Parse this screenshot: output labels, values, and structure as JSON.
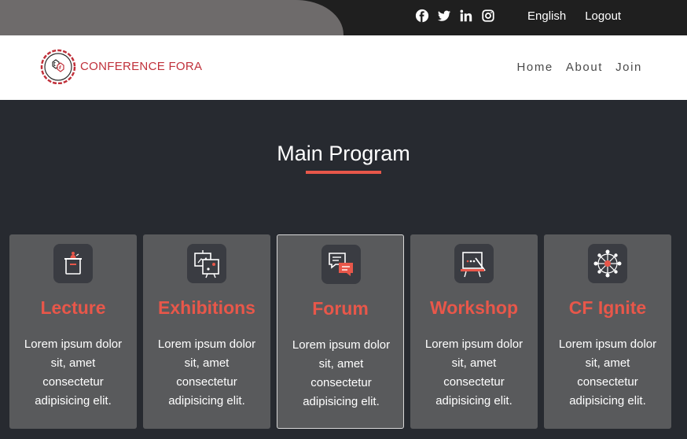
{
  "topbar": {
    "social": [
      "facebook-icon",
      "twitter-icon",
      "linkedin-icon",
      "instagram-icon"
    ],
    "links": [
      "English",
      "Logout"
    ]
  },
  "header": {
    "logo_text": "CONFERENCE FORA",
    "nav": [
      "Home",
      "About",
      "Join"
    ]
  },
  "section": {
    "title": "Main Program",
    "cards": [
      {
        "title": "Lecture",
        "icon": "lectern-icon",
        "text": "Lorem ipsum dolor sit, amet consectetur adipisicing elit."
      },
      {
        "title": "Exhibitions",
        "icon": "exhibition-board-icon",
        "text": "Lorem ipsum dolor sit, amet consectetur adipisicing elit."
      },
      {
        "title": "Forum",
        "icon": "chat-bubbles-icon",
        "text": "Lorem ipsum dolor sit, amet consectetur adipisicing elit."
      },
      {
        "title": "Workshop",
        "icon": "presentation-board-icon",
        "text": "Lorem ipsum dolor sit, amet consectetur adipisicing elit."
      },
      {
        "title": "CF Ignite",
        "icon": "network-icon",
        "text": "Lorem ipsum dolor sit, amet consectetur adipisicing elit."
      }
    ]
  },
  "colors": {
    "accent": "#e8574a",
    "background": "#272a30",
    "card": "#595a5c"
  }
}
